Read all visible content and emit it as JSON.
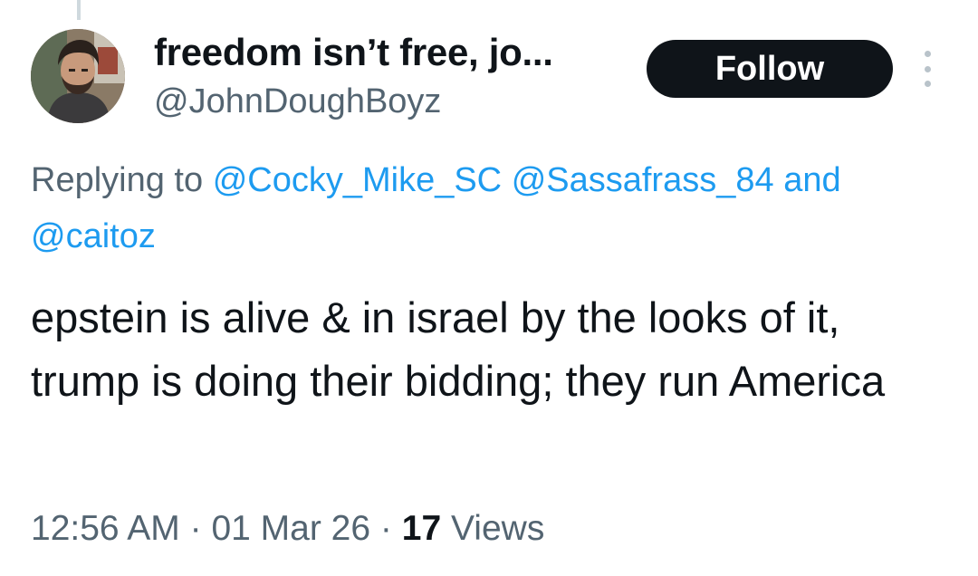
{
  "author": {
    "display_name": "freedom isn’t free, jo...",
    "handle": "@JohnDoughBoyz",
    "follow_label": "Follow"
  },
  "reply": {
    "prefix": "Replying to",
    "mentions": [
      "@Cocky_Mike_SC",
      "@Sassafrass_84",
      "@caitoz"
    ],
    "conjunction": "and"
  },
  "tweet": {
    "text": "epstein is alive & in israel by the looks of it, trump is doing their bidding; they run America",
    "time": "12:56 AM",
    "date": "01 Mar 26",
    "separator": "·",
    "views_count": "17",
    "views_label": "Views"
  },
  "colors": {
    "link": "#1d9bf0",
    "secondary_text": "#536471",
    "primary_text": "#0f1419",
    "follow_button_bg": "#0f1419"
  },
  "icons": {
    "more": "more-vertical-icon"
  }
}
